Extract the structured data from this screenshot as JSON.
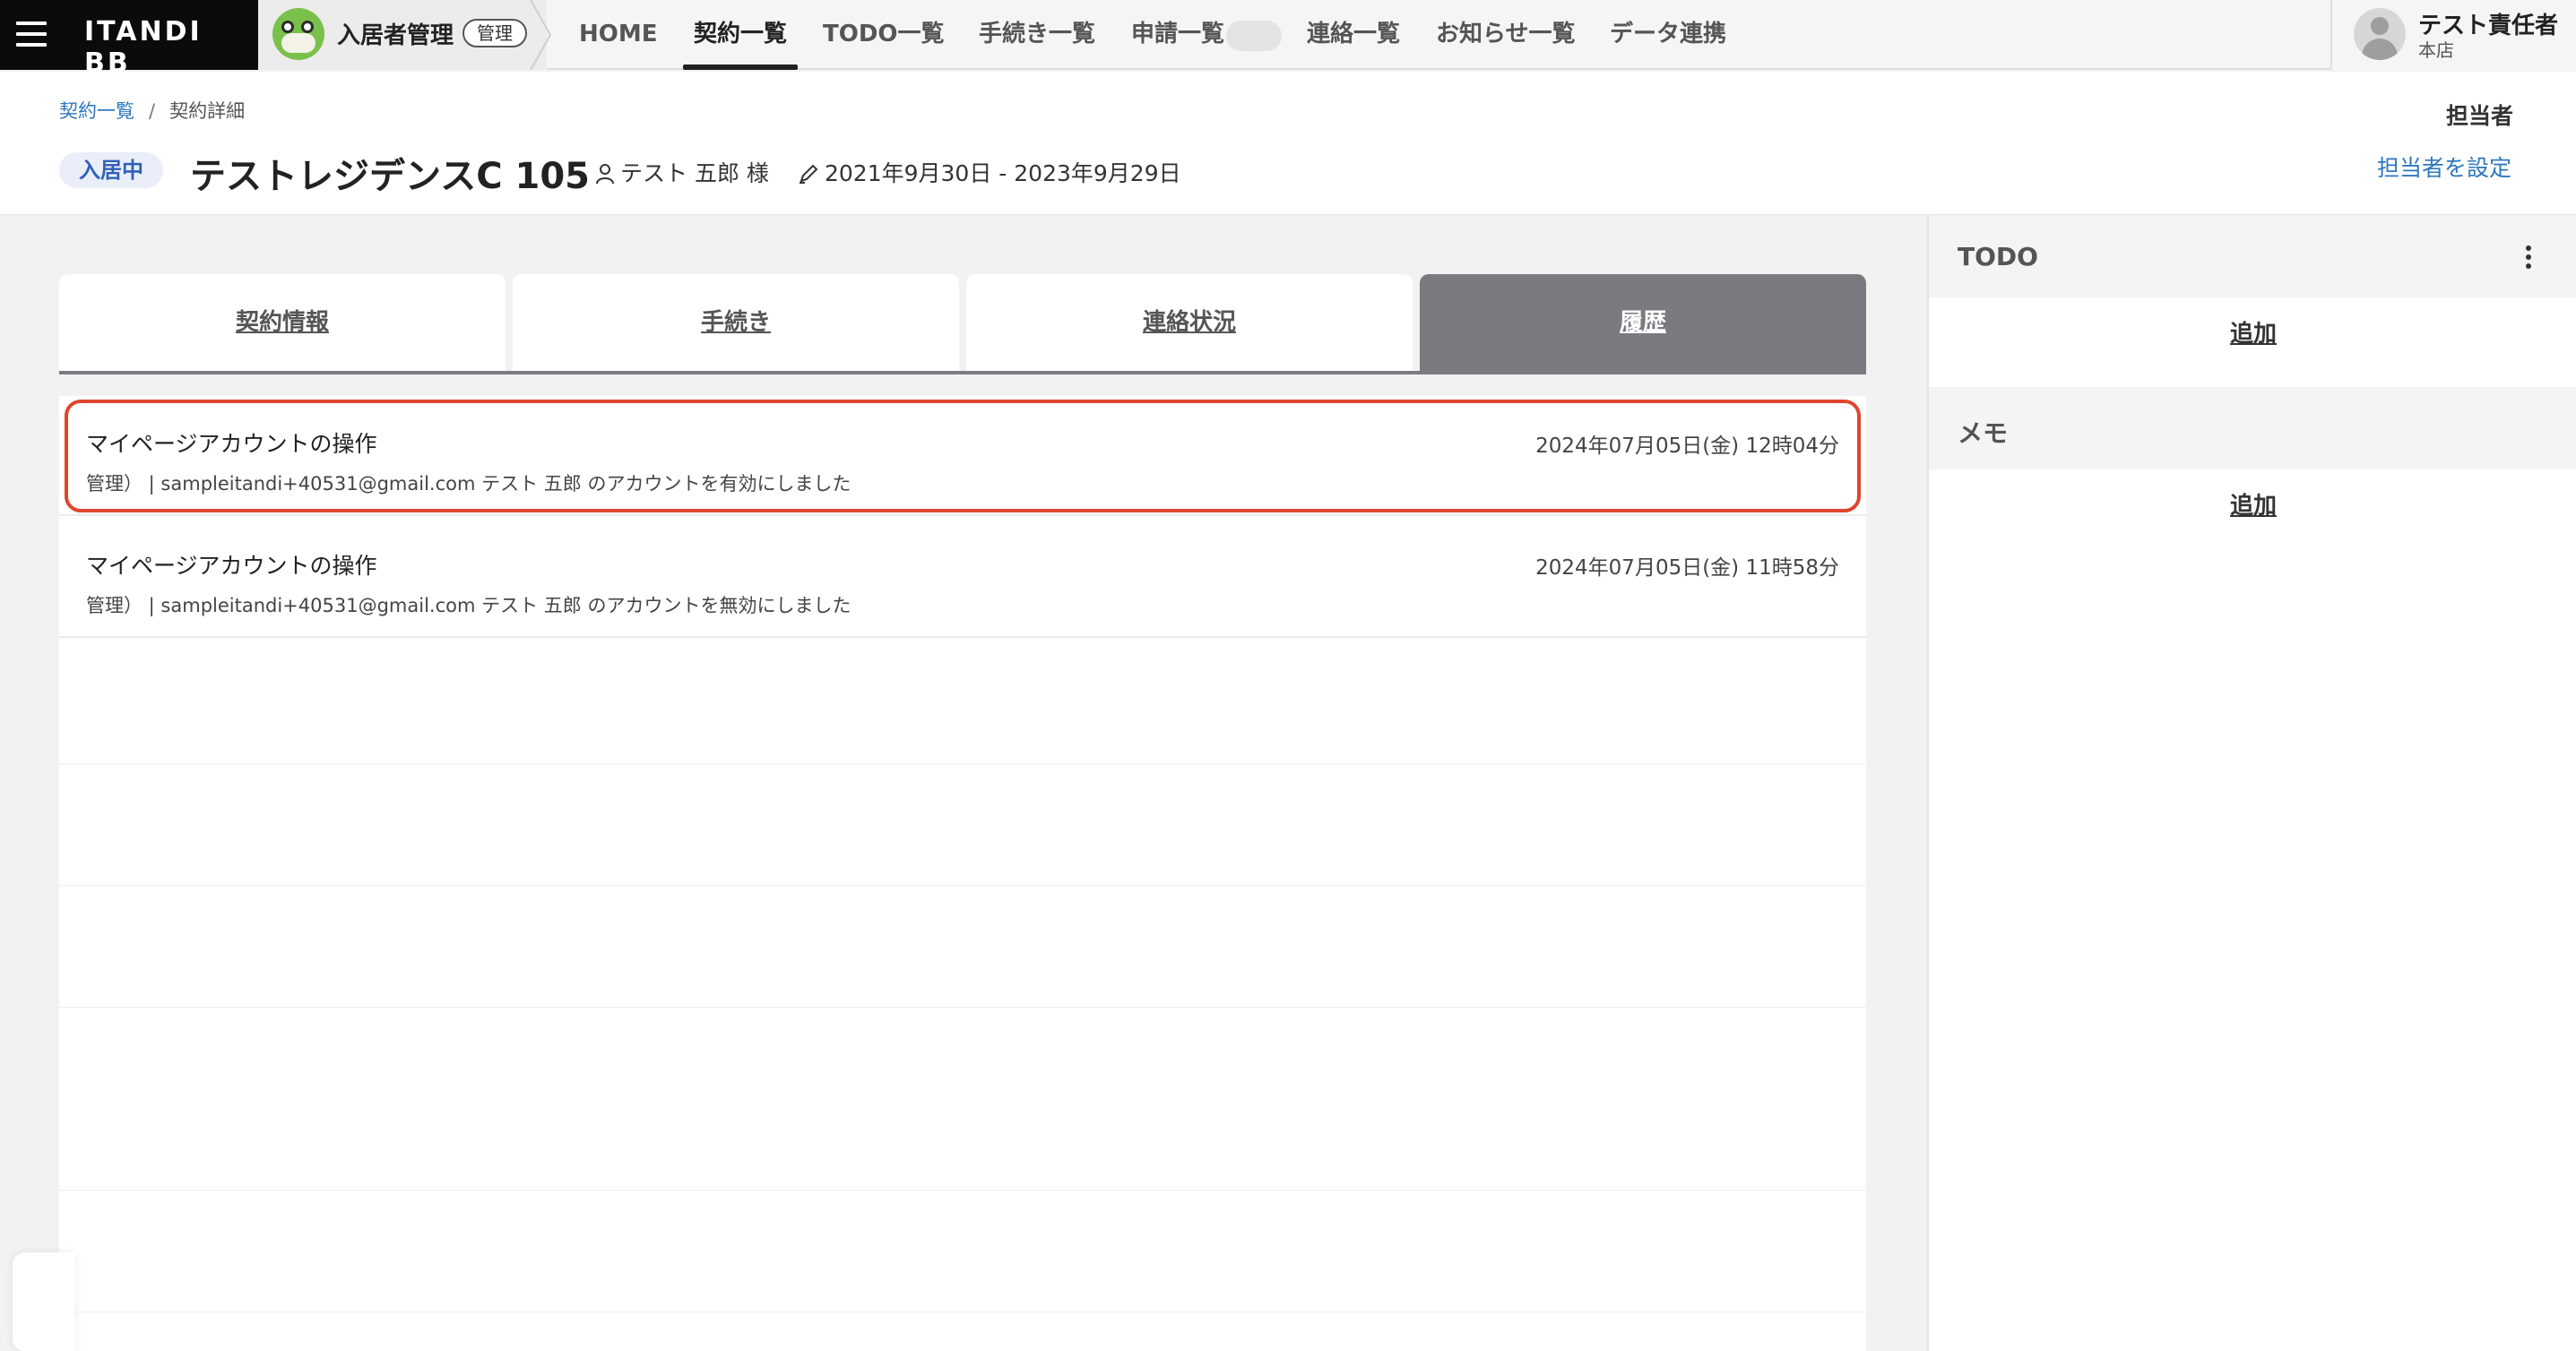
{
  "topnav": {
    "brand": "ITANDI BB",
    "product": {
      "name": "入居者管理",
      "badge": "管理"
    },
    "items": [
      {
        "label": "HOME"
      },
      {
        "label": "契約一覧"
      },
      {
        "label": "TODO一覧"
      },
      {
        "label": "手続き一覧"
      },
      {
        "label": "申請一覧"
      },
      {
        "label": "連絡一覧"
      },
      {
        "label": "お知らせ一覧"
      },
      {
        "label": "データ連携"
      }
    ],
    "active_item": "契約一覧",
    "user": {
      "name": "テスト責任者",
      "store": "本店"
    }
  },
  "header": {
    "breadcrumb": {
      "link": "契約一覧",
      "separator": "/",
      "current": "契約詳細"
    },
    "status": "入居中",
    "property_title": "テストレジデンスC 105",
    "tenant": "テスト 五郎 様",
    "period": "2021年9月30日 - 2023年9月29日",
    "staff_label": "担当者",
    "staff_link": "担当者を設定"
  },
  "tabs": [
    {
      "label": "契約情報"
    },
    {
      "label": "手続き"
    },
    {
      "label": "連絡状況"
    },
    {
      "label": "履歴"
    }
  ],
  "active_tab": "履歴",
  "history": [
    {
      "title": "マイページアカウントの操作",
      "time": "2024年07月05日(金) 12時04分",
      "detail": "管理）   |   sampleitandi+40531@gmail.com テスト 五郎 のアカウントを有効にしました",
      "highlighted": true
    },
    {
      "title": "マイページアカウントの操作",
      "time": "2024年07月05日(金) 11時58分",
      "detail": "管理）   |   sampleitandi+40531@gmail.com テスト 五郎 のアカウントを無効にしました",
      "highlighted": false
    }
  ],
  "sidebar": {
    "todo": {
      "title": "TODO",
      "add": "追加"
    },
    "memo": {
      "title": "メモ",
      "add": "追加"
    }
  },
  "colors": {
    "highlight": "#e0452e",
    "link": "#2f77bd",
    "active_tab": "#7a7a80",
    "status_badge_text": "#3160b8"
  }
}
